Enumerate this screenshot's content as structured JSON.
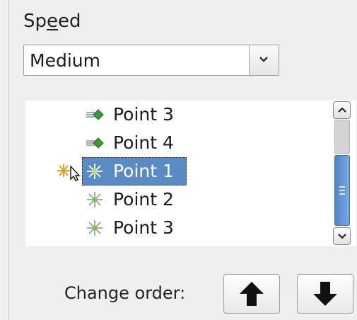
{
  "speed": {
    "label_prefix": "Sp",
    "label_mnemonic": "e",
    "label_suffix": "ed",
    "selected": "Medium",
    "dropdown_icon": "chevron-down-icon"
  },
  "effects_list": {
    "items": [
      {
        "label": "Point 3",
        "icon": "motion-path-icon",
        "selected": false
      },
      {
        "label": "Point 4",
        "icon": "motion-path-icon",
        "selected": false
      },
      {
        "label": "Point 1",
        "icon": "sparkle-icon",
        "selected": true
      },
      {
        "label": "Point 2",
        "icon": "sparkle-icon",
        "selected": false
      },
      {
        "label": "Point 3",
        "icon": "sparkle-icon",
        "selected": false
      }
    ]
  },
  "order": {
    "label": "Change order:",
    "up_icon": "arrow-up-icon",
    "down_icon": "arrow-down-icon"
  },
  "colors": {
    "selection": "#5a8bc4",
    "scroll_thumb": "#4f86c9",
    "motion_icon": "#3a9a3a"
  }
}
